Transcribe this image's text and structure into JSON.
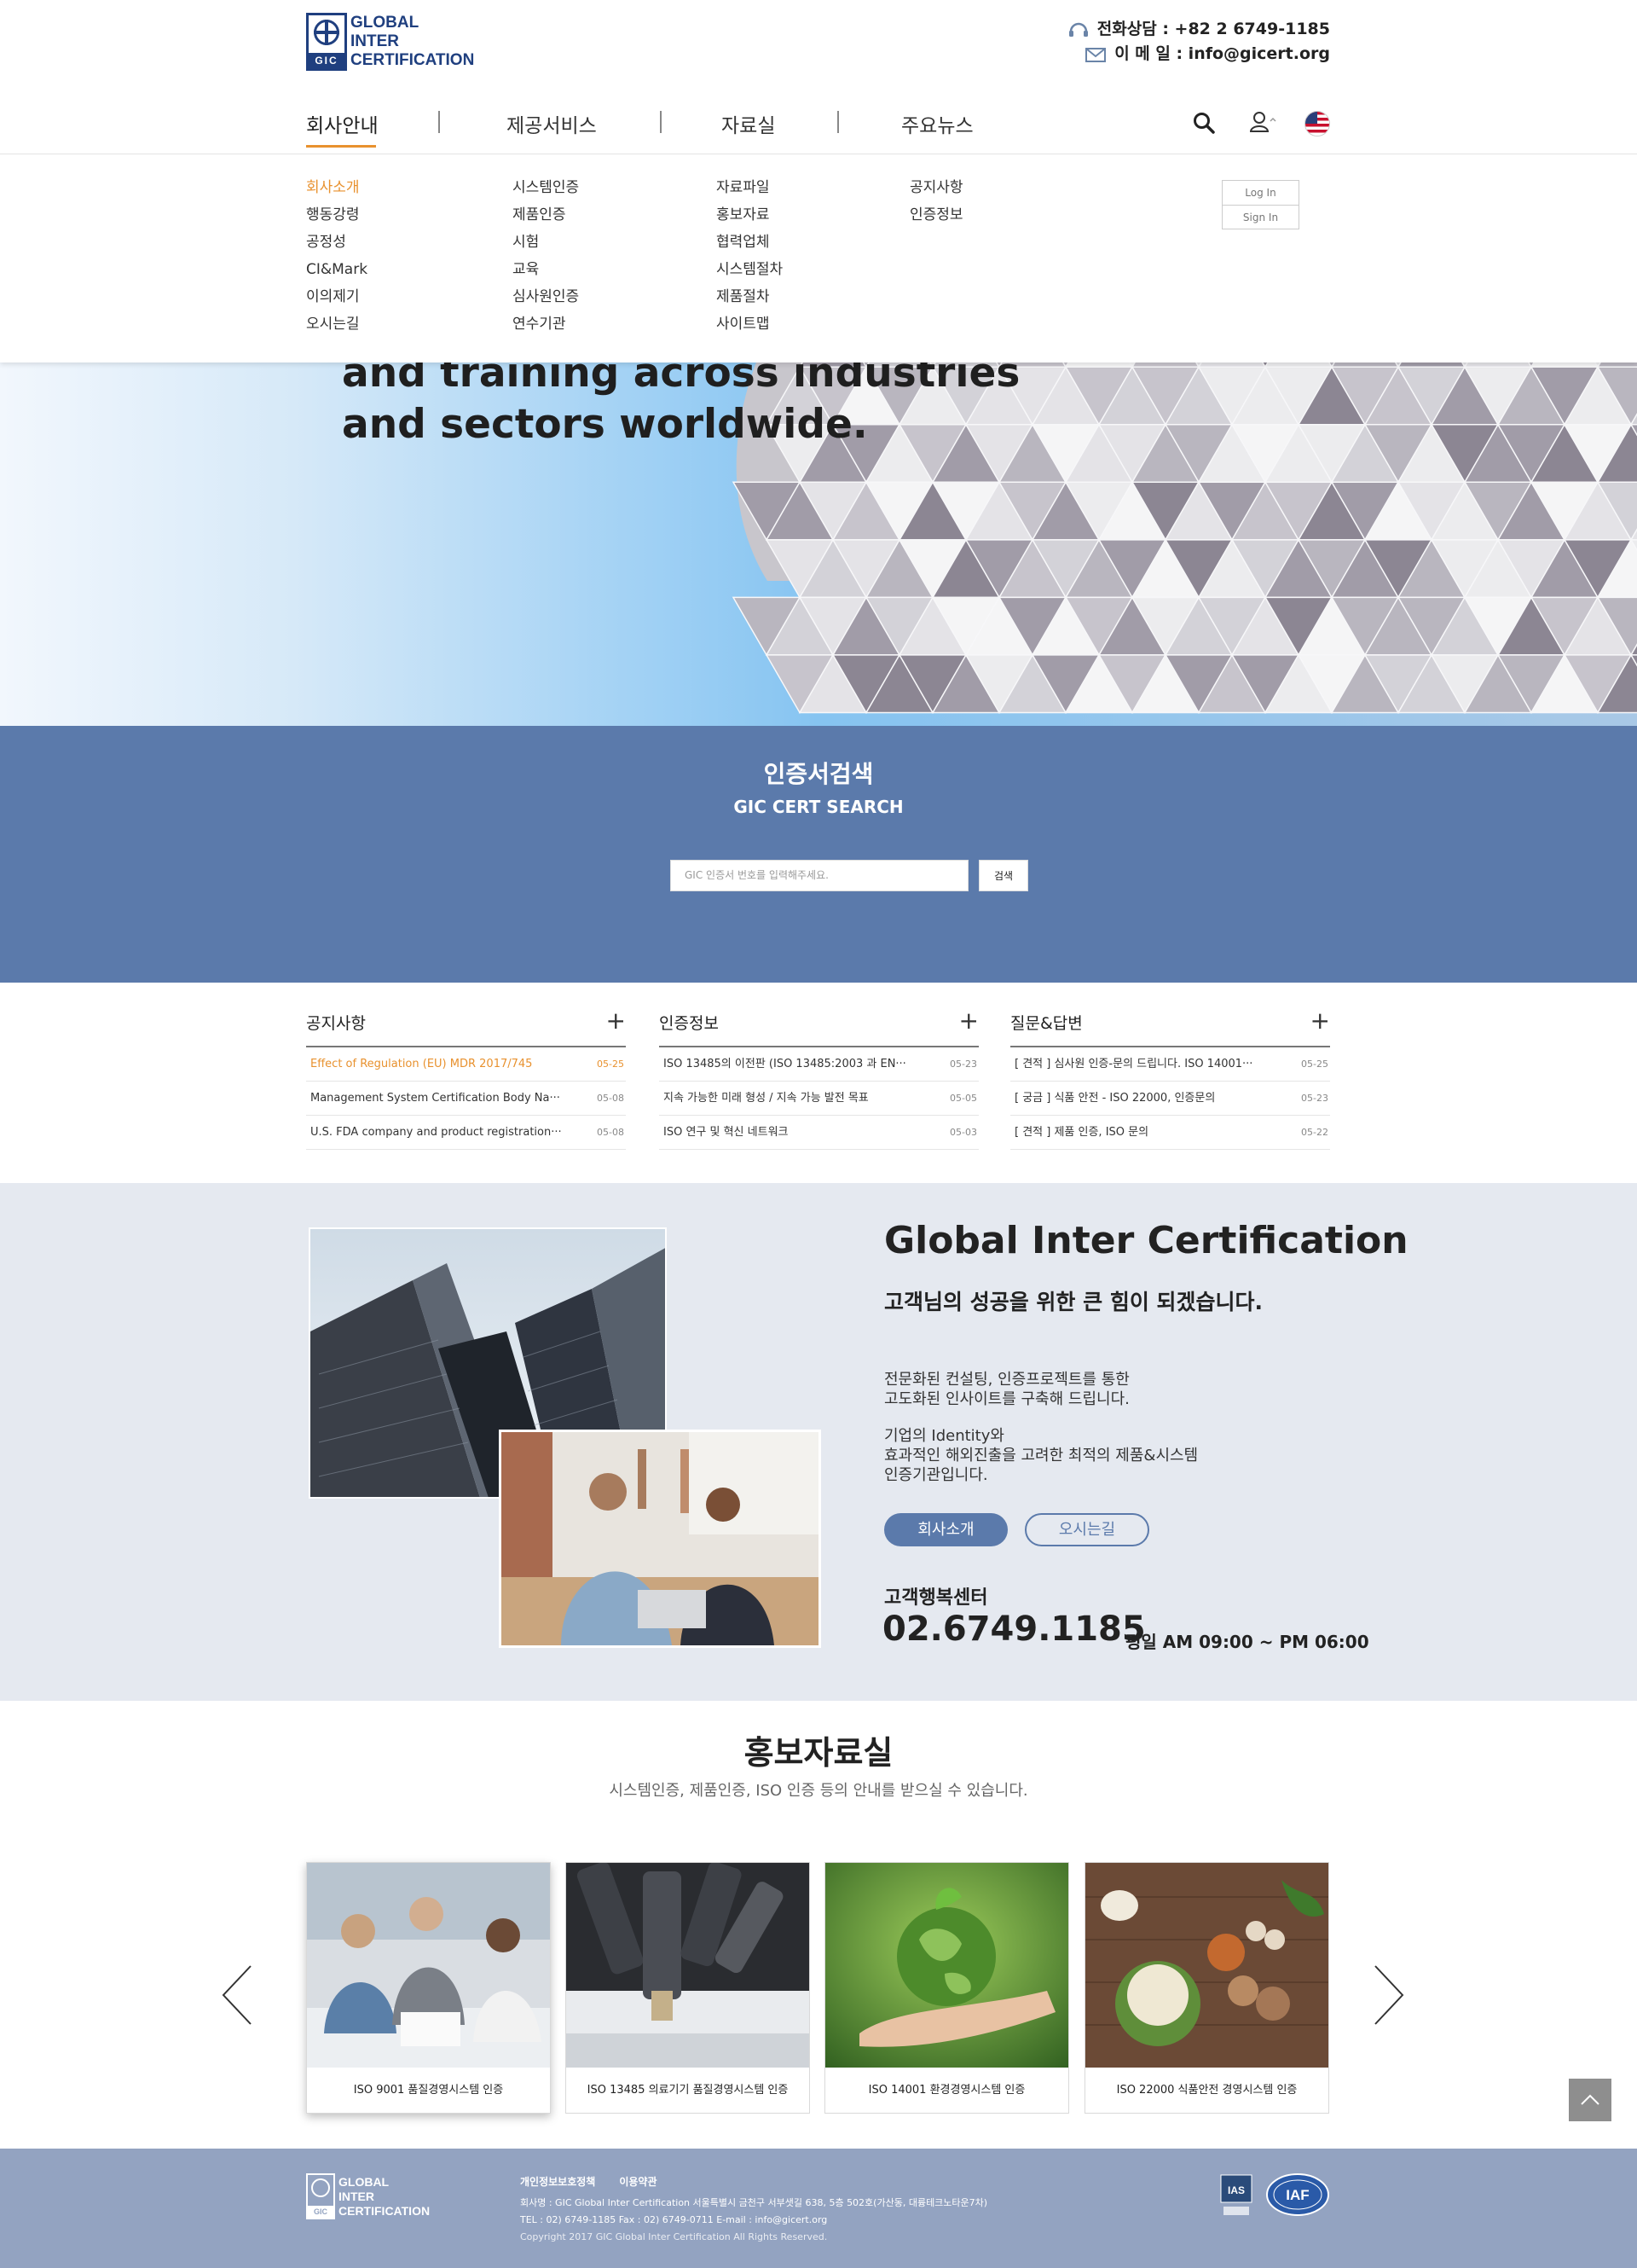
{
  "brand": {
    "logo_lines": [
      "GLOBAL",
      "INTER",
      "CERTIFICATION"
    ],
    "logo_mark": "GIC"
  },
  "contact": {
    "phone": "전화상담 : +82 2 6749-1185",
    "email": "이 메 일 : info@gicert.org",
    "phone_icon": "headset-icon",
    "email_icon": "mail-icon"
  },
  "nav": {
    "items": [
      "회사안내",
      "제공서비스",
      "자료실",
      "주요뉴스"
    ],
    "active_index": 0,
    "icons": [
      "search-icon",
      "user-icon",
      "us-flag-icon"
    ]
  },
  "submenu": {
    "col1": [
      "회사소개",
      "행동강령",
      "공정성",
      "CI&Mark",
      "이의제기",
      "오시는길"
    ],
    "col2": [
      "시스템인증",
      "제품인증",
      "시험",
      "교육",
      "심사원인증",
      "연수기관"
    ],
    "col3": [
      "자료파일",
      "홍보자료",
      "협력업체",
      "시스템절차",
      "제품절차",
      "사이트맵"
    ],
    "col4": [
      "공지사항",
      "인증정보"
    ]
  },
  "login": {
    "login_label": "Log In",
    "signin_label": "Sign In"
  },
  "hero": {
    "line1": "and training across industries",
    "line2": "and sectors worldwide.",
    "slides": 3,
    "active_slide": 0
  },
  "cert_search": {
    "title": "인증서검색",
    "subtitle": "GIC CERT SEARCH",
    "placeholder": "GIC 인증서 번호를 입력해주세요.",
    "button": "검색"
  },
  "boards": [
    {
      "title": "공지사항",
      "more": "+",
      "rows": [
        {
          "title": "Effect of Regulation (EU) MDR 2017/745",
          "date": "05-25",
          "highlight": true
        },
        {
          "title": "Management System Certification Body Na···",
          "date": "05-08"
        },
        {
          "title": "U.S. FDA company and product registration···",
          "date": "05-08"
        }
      ]
    },
    {
      "title": "인증정보",
      "more": "+",
      "rows": [
        {
          "title": "ISO 13485의 이전판 (ISO 13485:2003 과 EN···",
          "date": "05-23"
        },
        {
          "title": "지속 가능한 미래 형성 / 지속 가능 발전 목표",
          "date": "05-05"
        },
        {
          "title": "ISO 연구 및 혁신 네트워크",
          "date": "05-03"
        }
      ]
    },
    {
      "title": "질문&답변",
      "more": "+",
      "rows": [
        {
          "title": "[ 견적 ] 심사원 인증-문의 드립니다. ISO 14001···",
          "date": "05-25"
        },
        {
          "title": "[ 궁금 ] 식품 안전 - ISO 22000, 인증문의",
          "date": "05-23"
        },
        {
          "title": "[ 견적 ] 제품 인증, ISO 문의",
          "date": "05-22"
        }
      ]
    }
  ],
  "about": {
    "heading": "Global Inter Certification",
    "subheading": "고객님의 성공을 위한 큰 힘이 되겠습니다.",
    "para1": [
      "전문화된 컨설팅, 인증프로젝트를 통한",
      "고도화된 인사이트를 구축해 드립니다."
    ],
    "para2": [
      "기업의 Identity와",
      "효과적인 해외진출을 고려한 최적의 제품&시스템",
      "인증기관입니다."
    ],
    "btn_intro": "회사소개",
    "btn_map": "오시는길",
    "cs_label": "고객행복센터",
    "cs_phone": "02.6749.1185",
    "cs_hours": "평일 AM 09:00 ~ PM 06:00"
  },
  "pr": {
    "title": "홍보자료실",
    "subtitle": "시스템인증, 제품인증, ISO 인증 등의 안내를 받으실 수 있습니다.",
    "cards": [
      "ISO 9001 품질경영시스템 인증",
      "ISO 13485 의료기기 품질경영시스템 인증",
      "ISO 14001 환경경영시스템 인증",
      "ISO 22000 식품안전 경영시스템 인증"
    ]
  },
  "footer": {
    "logo_lines": [
      "GLOBAL",
      "INTER",
      "CERTIFICATION"
    ],
    "logo_mark": "GIC",
    "links": [
      "개인정보보호정책",
      "이용약관"
    ],
    "address": "회사명 : GIC Global Inter Certification    서울특별시 금천구 서부샛길 638, 5층 502호(가산동, 대륭테크노타운7차)",
    "tel": "TEL : 02) 6749-1185 Fax : 02) 6749-0711 E-mail : info@gicert.org",
    "copyright": "Copyright 2017 GIC Global Inter Certification All Rights Reserved.",
    "badge1": "IAS",
    "badge2": "IAF"
  }
}
